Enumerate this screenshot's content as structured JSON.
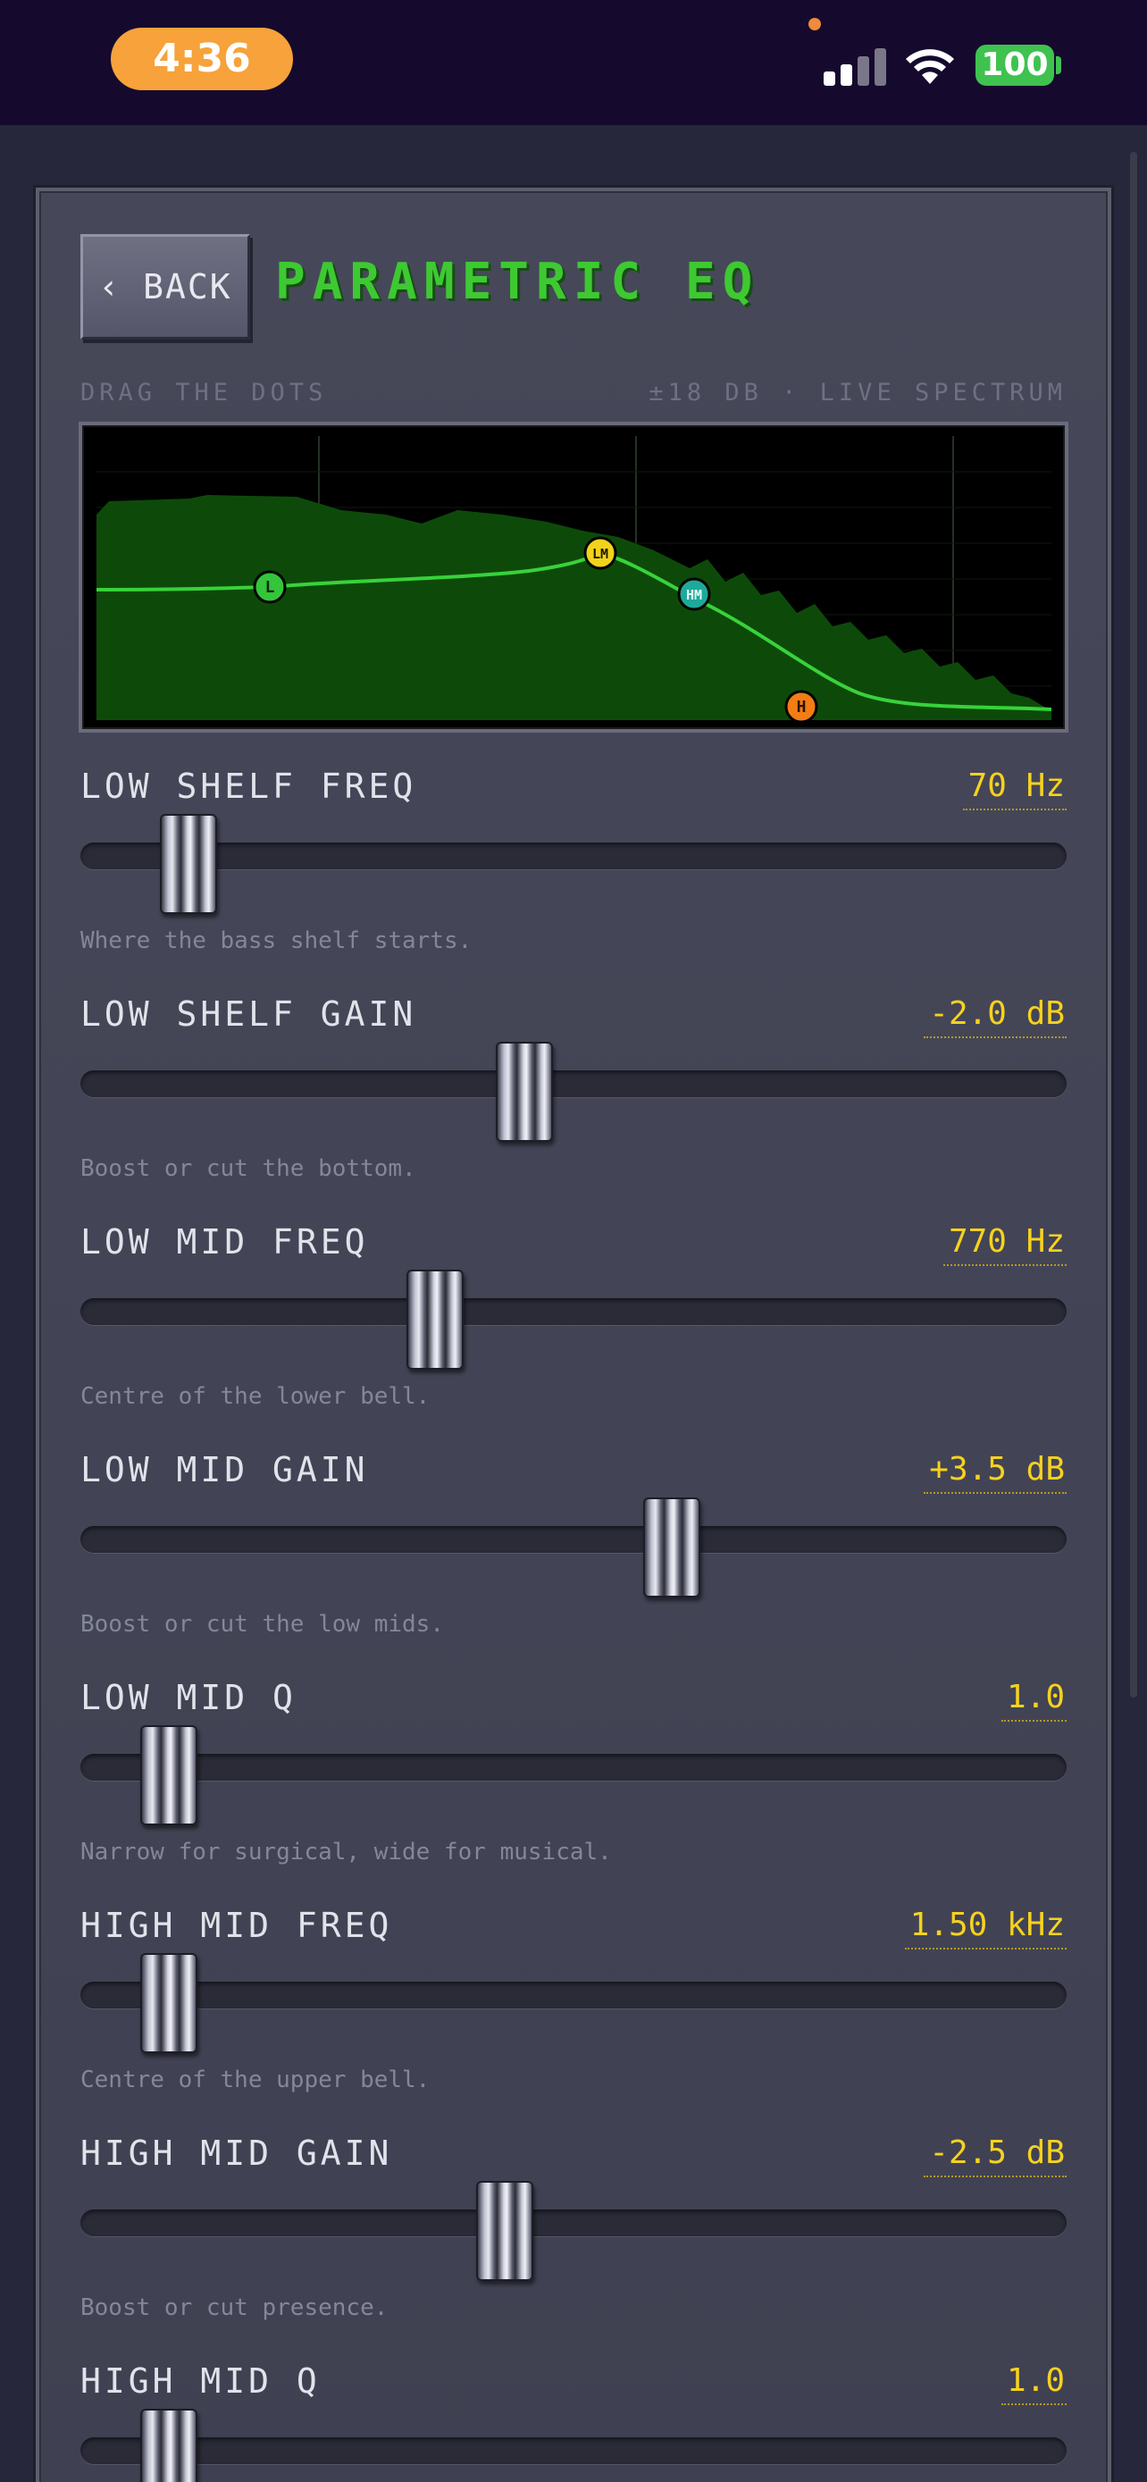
{
  "status_bar": {
    "time": "4:36",
    "battery": "100",
    "signal_bars": 4,
    "signal_active": 2
  },
  "header": {
    "back_label": "‹ BACK",
    "title": "PARAMETRIC EQ"
  },
  "eq_graph": {
    "hint_left": "DRAG THE DOTS",
    "hint_right": "±18 DB · LIVE SPECTRUM",
    "colors": {
      "curve": "#38d23a",
      "spectrum": "#0d4a0a",
      "grid": "#1e2a1e"
    },
    "nodes": [
      {
        "label": "L",
        "color": "#34c53a",
        "text_color": "#0b2a0b"
      },
      {
        "label": "LM",
        "color": "#f2d21c",
        "text_color": "#1a1a00"
      },
      {
        "label": "HM",
        "color": "#1fa99a",
        "text_color": "#e0fff8"
      },
      {
        "label": "H",
        "color": "#f27d14",
        "text_color": "#2a1200"
      }
    ]
  },
  "params": [
    {
      "label": "LOW SHELF FREQ",
      "value": "70 Hz",
      "description": "Where the bass shelf starts.",
      "level": 0.11
    },
    {
      "label": "LOW SHELF GAIN",
      "value": "-2.0 dB",
      "description": "Boost or cut the bottom.",
      "level": 0.45
    },
    {
      "label": "LOW MID FREQ",
      "value": "770 Hz",
      "description": "Centre of the lower bell.",
      "level": 0.36
    },
    {
      "label": "LOW MID GAIN",
      "value": "+3.5 dB",
      "description": "Boost or cut the low mids.",
      "level": 0.6
    },
    {
      "label": "LOW MID Q",
      "value": "1.0",
      "description": "Narrow for surgical, wide for musical.",
      "level": 0.09
    },
    {
      "label": "HIGH MID FREQ",
      "value": "1.50 kHz",
      "description": "Centre of the upper bell.",
      "level": 0.09
    },
    {
      "label": "HIGH MID GAIN",
      "value": "-2.5 dB",
      "description": "Boost or cut presence.",
      "level": 0.43
    },
    {
      "label": "HIGH MID Q",
      "value": "1.0",
      "description": "",
      "level": 0.09
    }
  ]
}
